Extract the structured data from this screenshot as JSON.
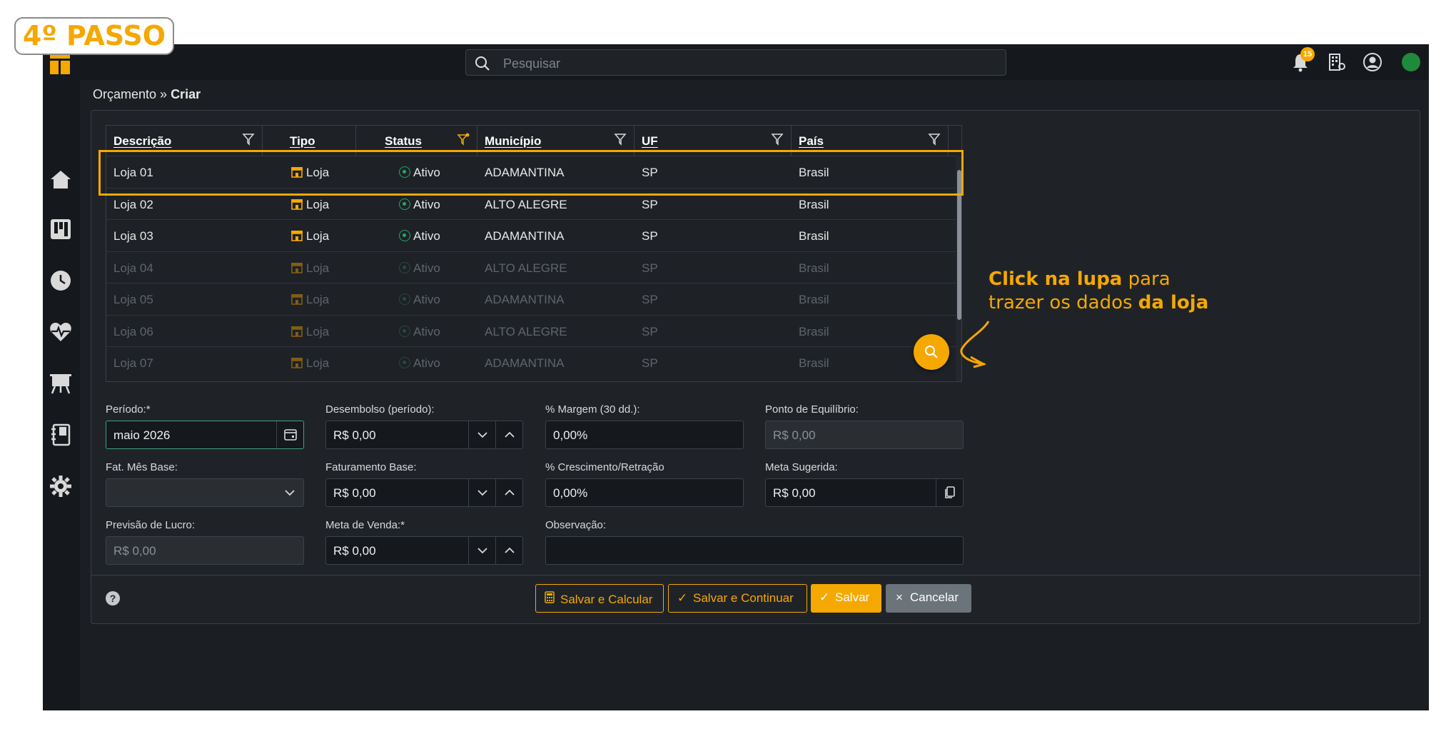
{
  "annotation": {
    "step_label": "4º PASSO",
    "callout_bold1": "Click na lupa",
    "callout_text1": " para",
    "callout_text2": "trazer os dados ",
    "callout_bold2": "da loja"
  },
  "topbar": {
    "search_placeholder": "Pesquisar",
    "notification_count": "15"
  },
  "breadcrumb": {
    "parent": "Orçamento",
    "separator": " » ",
    "current": "Criar"
  },
  "grid": {
    "columns": [
      "Descrição",
      "Tipo",
      "Status",
      "Município",
      "UF",
      "País"
    ],
    "rows": [
      {
        "descricao": "Loja 01",
        "tipo": "Loja",
        "status": "Ativo",
        "municipio": "ADAMANTINA",
        "uf": "SP",
        "pais": "Brasil"
      },
      {
        "descricao": "Loja 02",
        "tipo": "Loja",
        "status": "Ativo",
        "municipio": "ALTO ALEGRE",
        "uf": "SP",
        "pais": "Brasil"
      },
      {
        "descricao": "Loja 03",
        "tipo": "Loja",
        "status": "Ativo",
        "municipio": "ADAMANTINA",
        "uf": "SP",
        "pais": "Brasil"
      },
      {
        "descricao": "Loja 04",
        "tipo": "Loja",
        "status": "Ativo",
        "municipio": "ALTO ALEGRE",
        "uf": "SP",
        "pais": "Brasil"
      },
      {
        "descricao": "Loja 05",
        "tipo": "Loja",
        "status": "Ativo",
        "municipio": "ADAMANTINA",
        "uf": "SP",
        "pais": "Brasil"
      },
      {
        "descricao": "Loja 06",
        "tipo": "Loja",
        "status": "Ativo",
        "municipio": "ALTO ALEGRE",
        "uf": "SP",
        "pais": "Brasil"
      },
      {
        "descricao": "Loja 07",
        "tipo": "Loja",
        "status": "Ativo",
        "municipio": "ADAMANTINA",
        "uf": "SP",
        "pais": "Brasil"
      }
    ]
  },
  "form": {
    "periodo_label": "Período:*",
    "periodo_value": "maio 2026",
    "desembolso_label": "Desembolso (período):",
    "desembolso_value": "R$ 0,00",
    "margem_label": "% Margem (30 dd.):",
    "margem_value": "0,00%",
    "equilibrio_label": "Ponto de Equilíbrio:",
    "equilibrio_value": "R$ 0,00",
    "fat_mes_label": "Fat. Mês Base:",
    "fat_mes_value": "",
    "faturamento_label": "Faturamento Base:",
    "faturamento_value": "R$ 0,00",
    "crescimento_label": "% Crescimento/Retração",
    "crescimento_value": "0,00%",
    "meta_sugerida_label": "Meta Sugerida:",
    "meta_sugerida_value": "R$ 0,00",
    "lucro_label": "Previsão de Lucro:",
    "lucro_value": "R$ 0,00",
    "meta_venda_label": "Meta de Venda:*",
    "meta_venda_value": "R$ 0,00",
    "observacao_label": "Observação:",
    "observacao_value": ""
  },
  "footer": {
    "help": "?",
    "salvar_calcular": "Salvar e Calcular",
    "salvar_continuar": "Salvar e Continuar",
    "salvar": "Salvar",
    "cancelar": "Cancelar"
  },
  "colors": {
    "accent": "#f5a800",
    "status_active": "#22a866",
    "online": "#1f8a3c"
  }
}
